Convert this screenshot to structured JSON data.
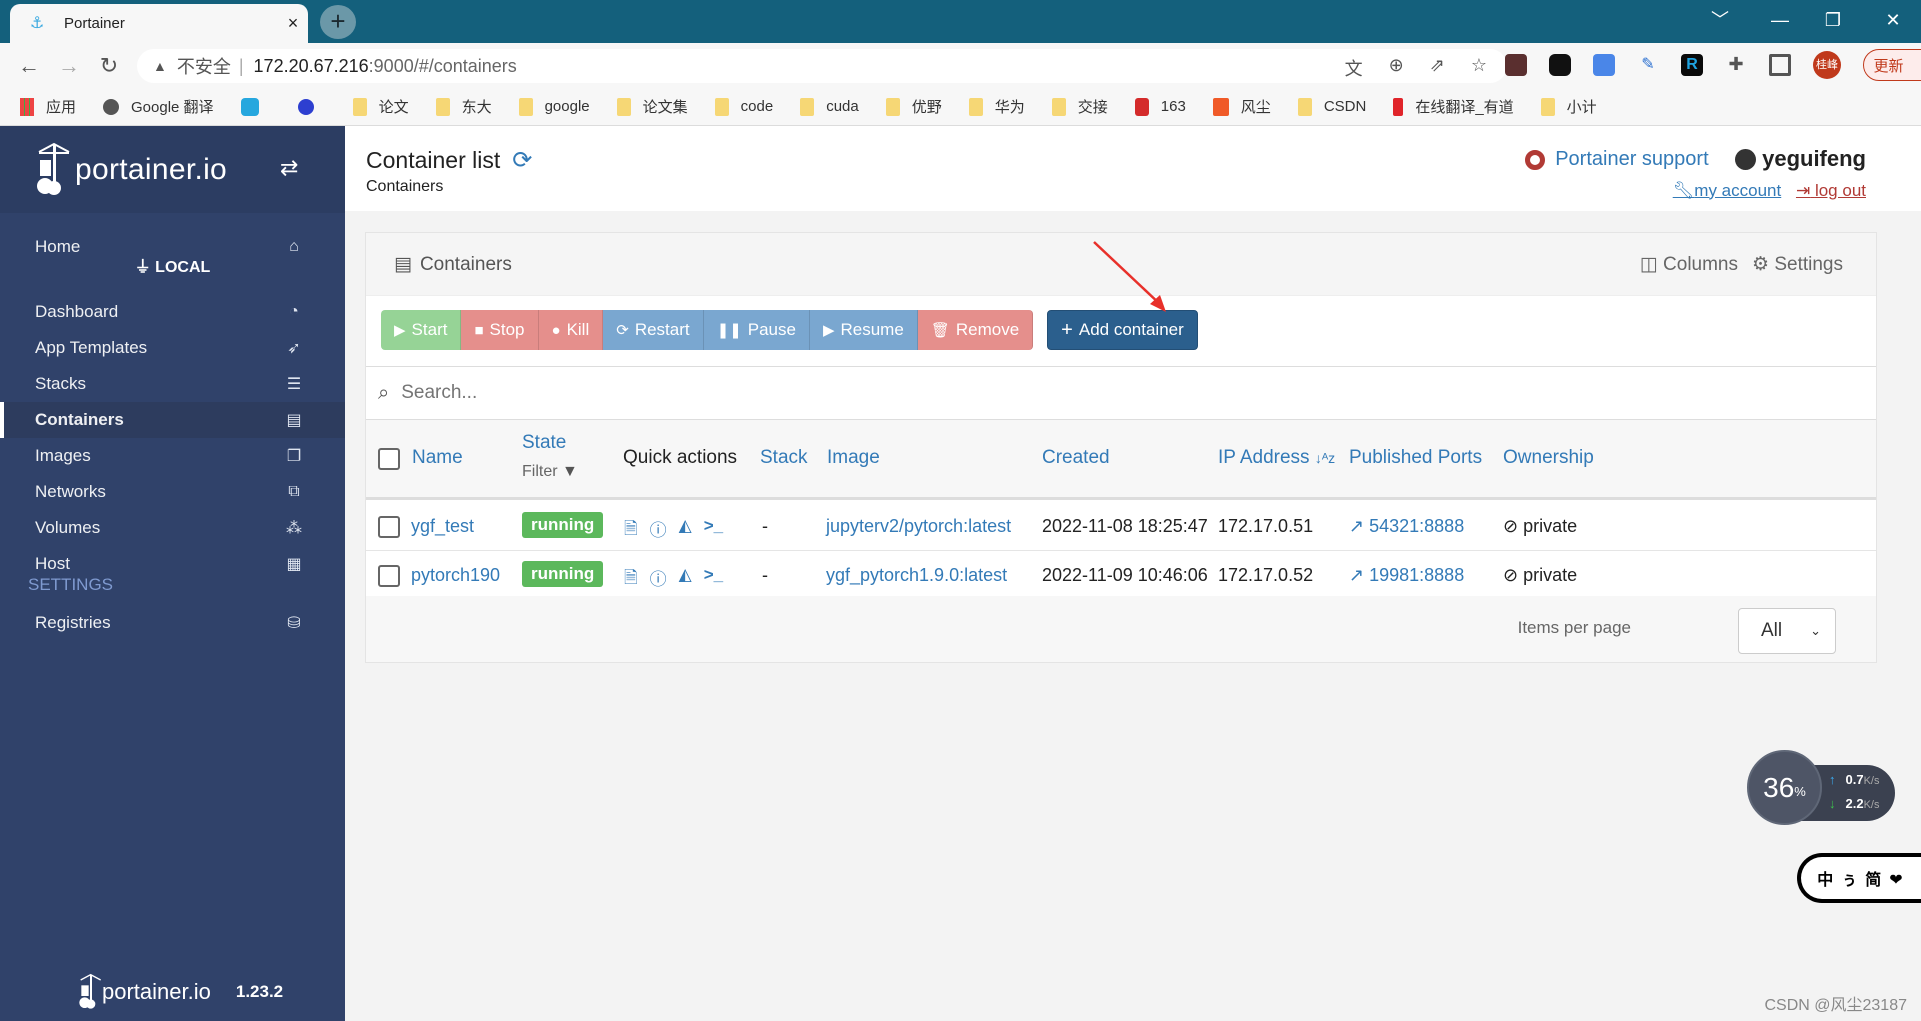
{
  "browser": {
    "tab_title": "Portainer",
    "tab_close": "×",
    "new_tab": "+",
    "window_controls": [
      "﹀",
      "—",
      "❐",
      "✕"
    ],
    "nav": {
      "back": "←",
      "forward": "→",
      "reload": "↻"
    },
    "address": {
      "warning_icon": "▲",
      "insecure_label": "不安全",
      "separator": "|",
      "host": "172.20.67.216",
      "path": ":9000/#/containers"
    },
    "omnibox_icons": [
      "translate-icon",
      "zoom-icon",
      "share-icon",
      "star-icon"
    ],
    "avatar_label": "桂峰",
    "update_label": "更新",
    "menu_icon": "⋮",
    "bookmarks": [
      {
        "label": "应用",
        "icon": "apps-grid-icon"
      },
      {
        "label": "Google 翻译",
        "icon": "globe-icon"
      },
      {
        "label": "",
        "icon": "bilibili-icon"
      },
      {
        "label": "",
        "icon": "baidu-paw-icon"
      },
      {
        "label": "论文",
        "icon": "folder-icon"
      },
      {
        "label": "东大",
        "icon": "folder-icon"
      },
      {
        "label": "google",
        "icon": "folder-icon"
      },
      {
        "label": "论文集",
        "icon": "folder-icon"
      },
      {
        "label": "code",
        "icon": "folder-icon"
      },
      {
        "label": "cuda",
        "icon": "folder-icon"
      },
      {
        "label": "优野",
        "icon": "folder-icon"
      },
      {
        "label": "华为",
        "icon": "folder-icon"
      },
      {
        "label": "交接",
        "icon": "folder-icon"
      },
      {
        "label": "163",
        "icon": "netease-icon"
      },
      {
        "label": "风尘",
        "icon": "csdn-c-icon"
      },
      {
        "label": "CSDN",
        "icon": "folder-icon"
      },
      {
        "label": "在线翻译_有道",
        "icon": "youdao-icon"
      },
      {
        "label": "小计",
        "icon": "folder-icon"
      }
    ]
  },
  "sidebar": {
    "brand": "portainer.io",
    "toggle_icon": "⇄",
    "home": {
      "label": "Home",
      "icon": "home-icon"
    },
    "endpoint": "LOCAL",
    "items": [
      {
        "label": "Dashboard",
        "icon": "tachometer-icon",
        "glyph": "◔"
      },
      {
        "label": "App Templates",
        "icon": "rocket-icon",
        "glyph": "➶"
      },
      {
        "label": "Stacks",
        "icon": "th-list-icon",
        "glyph": "☰"
      },
      {
        "label": "Containers",
        "icon": "server-icon",
        "glyph": "▤",
        "active": true
      },
      {
        "label": "Images",
        "icon": "clone-icon",
        "glyph": "❐"
      },
      {
        "label": "Networks",
        "icon": "sitemap-icon",
        "glyph": "⧉"
      },
      {
        "label": "Volumes",
        "icon": "cubes-icon",
        "glyph": "⁂"
      },
      {
        "label": "Host",
        "icon": "th-icon",
        "glyph": "▦"
      }
    ],
    "settings_heading": "SETTINGS",
    "settings_items": [
      {
        "label": "Registries",
        "icon": "database-icon",
        "glyph": "⛁"
      }
    ],
    "footer_brand": "portainer.io",
    "version": "1.23.2"
  },
  "header": {
    "title": "Container list",
    "breadcrumb": "Containers",
    "support_label": "Portainer support",
    "username": "yeguifeng",
    "my_account": "my account",
    "log_out": "log out"
  },
  "panel": {
    "title": "Containers",
    "columns_label": "Columns",
    "settings_label": "Settings",
    "actions": {
      "start": "Start",
      "stop": "Stop",
      "kill": "Kill",
      "restart": "Restart",
      "pause": "Pause",
      "resume": "Resume",
      "remove": "Remove",
      "add": "Add container"
    },
    "search_placeholder": "Search...",
    "columns": {
      "name": "Name",
      "state": "State",
      "state_filter": "Filter",
      "quick_actions": "Quick actions",
      "stack": "Stack",
      "image": "Image",
      "created": "Created",
      "ip": "IP Address",
      "ports": "Published Ports",
      "ownership": "Ownership"
    },
    "rows": [
      {
        "name": "ygf_test",
        "state": "running",
        "stack": "-",
        "image": "jupyterv2/pytorch:latest",
        "created": "2022-11-08 18:25:47",
        "ip": "172.17.0.51",
        "ports": "54321:8888",
        "ownership": "private"
      },
      {
        "name": "pytorch190",
        "state": "running",
        "stack": "-",
        "image": "ygf_pytorch1.9.0:latest",
        "created": "2022-11-09 10:46:06",
        "ip": "172.17.0.52",
        "ports": "19981:8888",
        "ownership": "private"
      }
    ],
    "items_per_page_label": "Items per page",
    "items_per_page_value": "All"
  },
  "overlays": {
    "netmon": {
      "percent": "36",
      "percent_unit": "%",
      "up": "0.7",
      "down": "2.2",
      "unit": "K/s"
    },
    "ime_text": "中ぅ简❤",
    "watermark": "CSDN @风尘23187"
  },
  "colors": {
    "sidebar_bg": "#30426a",
    "link": "#337ab7",
    "running": "#5cb85c",
    "primary_button": "#2b5f8d",
    "titlebar": "#14607c"
  }
}
